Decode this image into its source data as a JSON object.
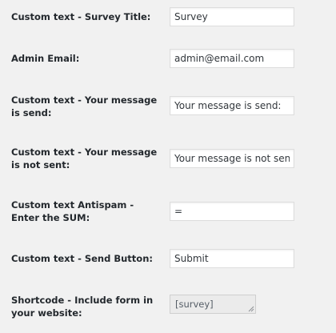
{
  "settings": {
    "rows": [
      {
        "label": "Custom text - Survey Title:",
        "value": "Survey"
      },
      {
        "label": "Admin Email:",
        "value": "admin@email.com"
      },
      {
        "label": "Custom text - Your message is send:",
        "value": "Your message is send:"
      },
      {
        "label": "Custom text - Your message is not sent:",
        "value": "Your message is not sent:"
      },
      {
        "label": "Custom text Antispam - Enter the SUM:",
        "value": "="
      },
      {
        "label": "Custom text - Send Button:",
        "value": "Submit"
      }
    ],
    "shortcode": {
      "label": "Shortcode - Include form in your website:",
      "value": "[survey]"
    }
  }
}
